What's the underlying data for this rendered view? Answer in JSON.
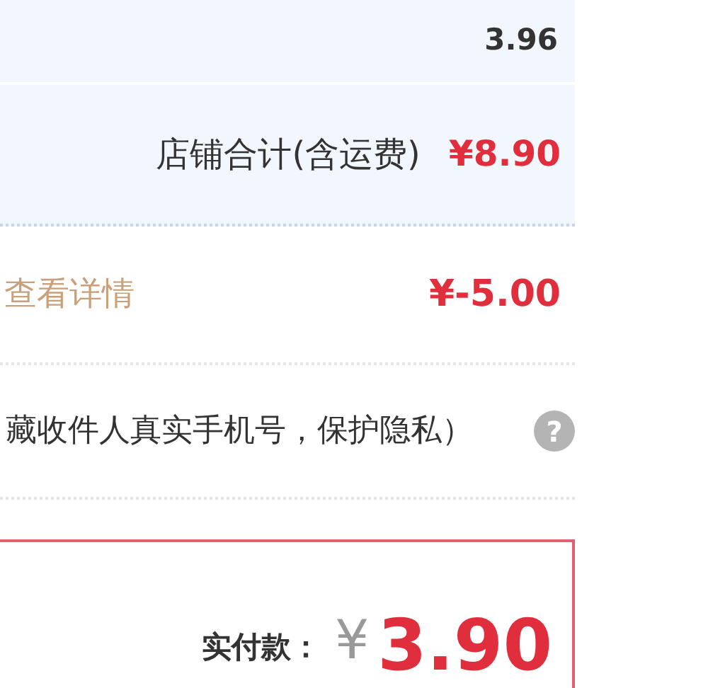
{
  "summary_rows": [
    {
      "value": "3.96"
    },
    {
      "label": "店铺合计(含运费)",
      "price": "¥8.90"
    }
  ],
  "discount": {
    "link": "查看详情",
    "amount": "¥-5.00"
  },
  "privacy": {
    "text": "藏收件人真实手机号，保护隐私）",
    "help": "?"
  },
  "payment": {
    "label": "实付款：",
    "currency": "¥",
    "amount": "3.90"
  }
}
